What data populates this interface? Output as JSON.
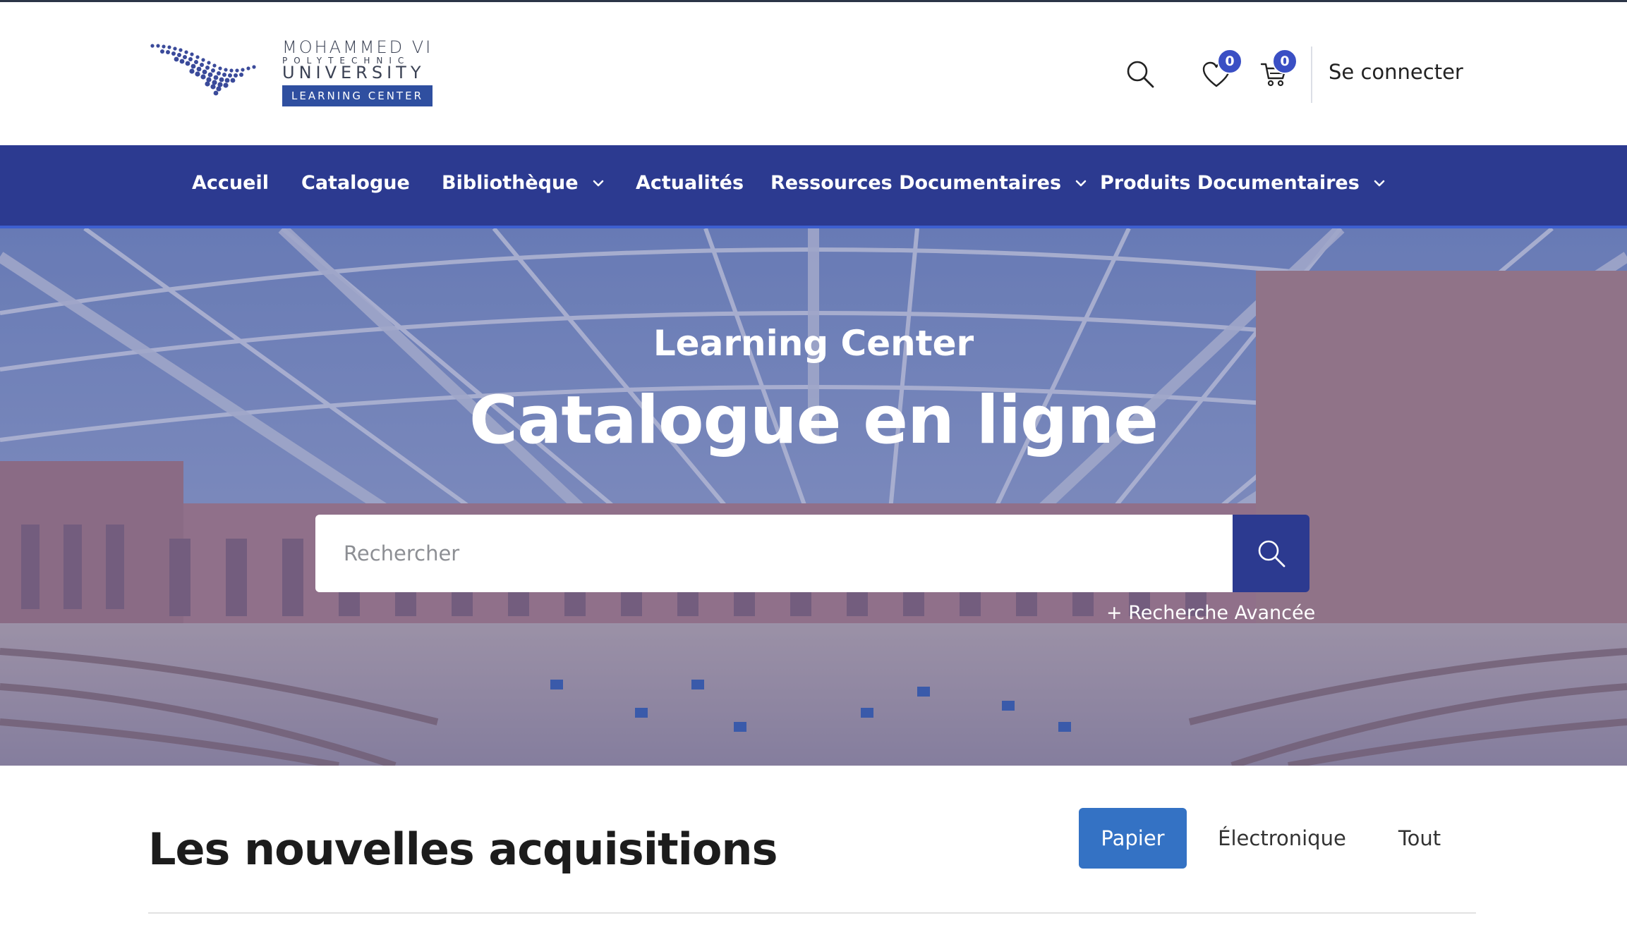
{
  "brand": {
    "line1": "MOHAMMED VI",
    "line2": "POLYTECHNIC",
    "line3": "UNIVERSITY",
    "badge": "LEARNING CENTER"
  },
  "header": {
    "wishlist_count": "0",
    "cart_count": "0",
    "login_label": "Se connecter"
  },
  "nav": {
    "items": [
      {
        "label": "Accueil",
        "has_dropdown": false
      },
      {
        "label": "Catalogue",
        "has_dropdown": false
      },
      {
        "label": "Bibliothèque",
        "has_dropdown": true
      },
      {
        "label": "Actualités",
        "has_dropdown": false
      },
      {
        "label": "Ressources Documentaires",
        "has_dropdown": true
      },
      {
        "label": "Produits Documentaires",
        "has_dropdown": true
      }
    ]
  },
  "hero": {
    "subtitle": "Learning Center",
    "title": "Catalogue en ligne",
    "search_placeholder": "Rechercher",
    "advanced_search": "+ Recherche Avancée"
  },
  "acquisitions": {
    "title": "Les nouvelles acquisitions",
    "tabs": [
      {
        "label": "Papier",
        "active": true
      },
      {
        "label": "Électronique",
        "active": false
      },
      {
        "label": "Tout",
        "active": false
      }
    ]
  },
  "colors": {
    "nav_bg": "#2c3a90",
    "accent_badge": "#3a4fc4",
    "tab_active": "#3472c4"
  },
  "icons": [
    "search-icon",
    "heart-icon",
    "cart-icon",
    "chevron-down-icon"
  ]
}
